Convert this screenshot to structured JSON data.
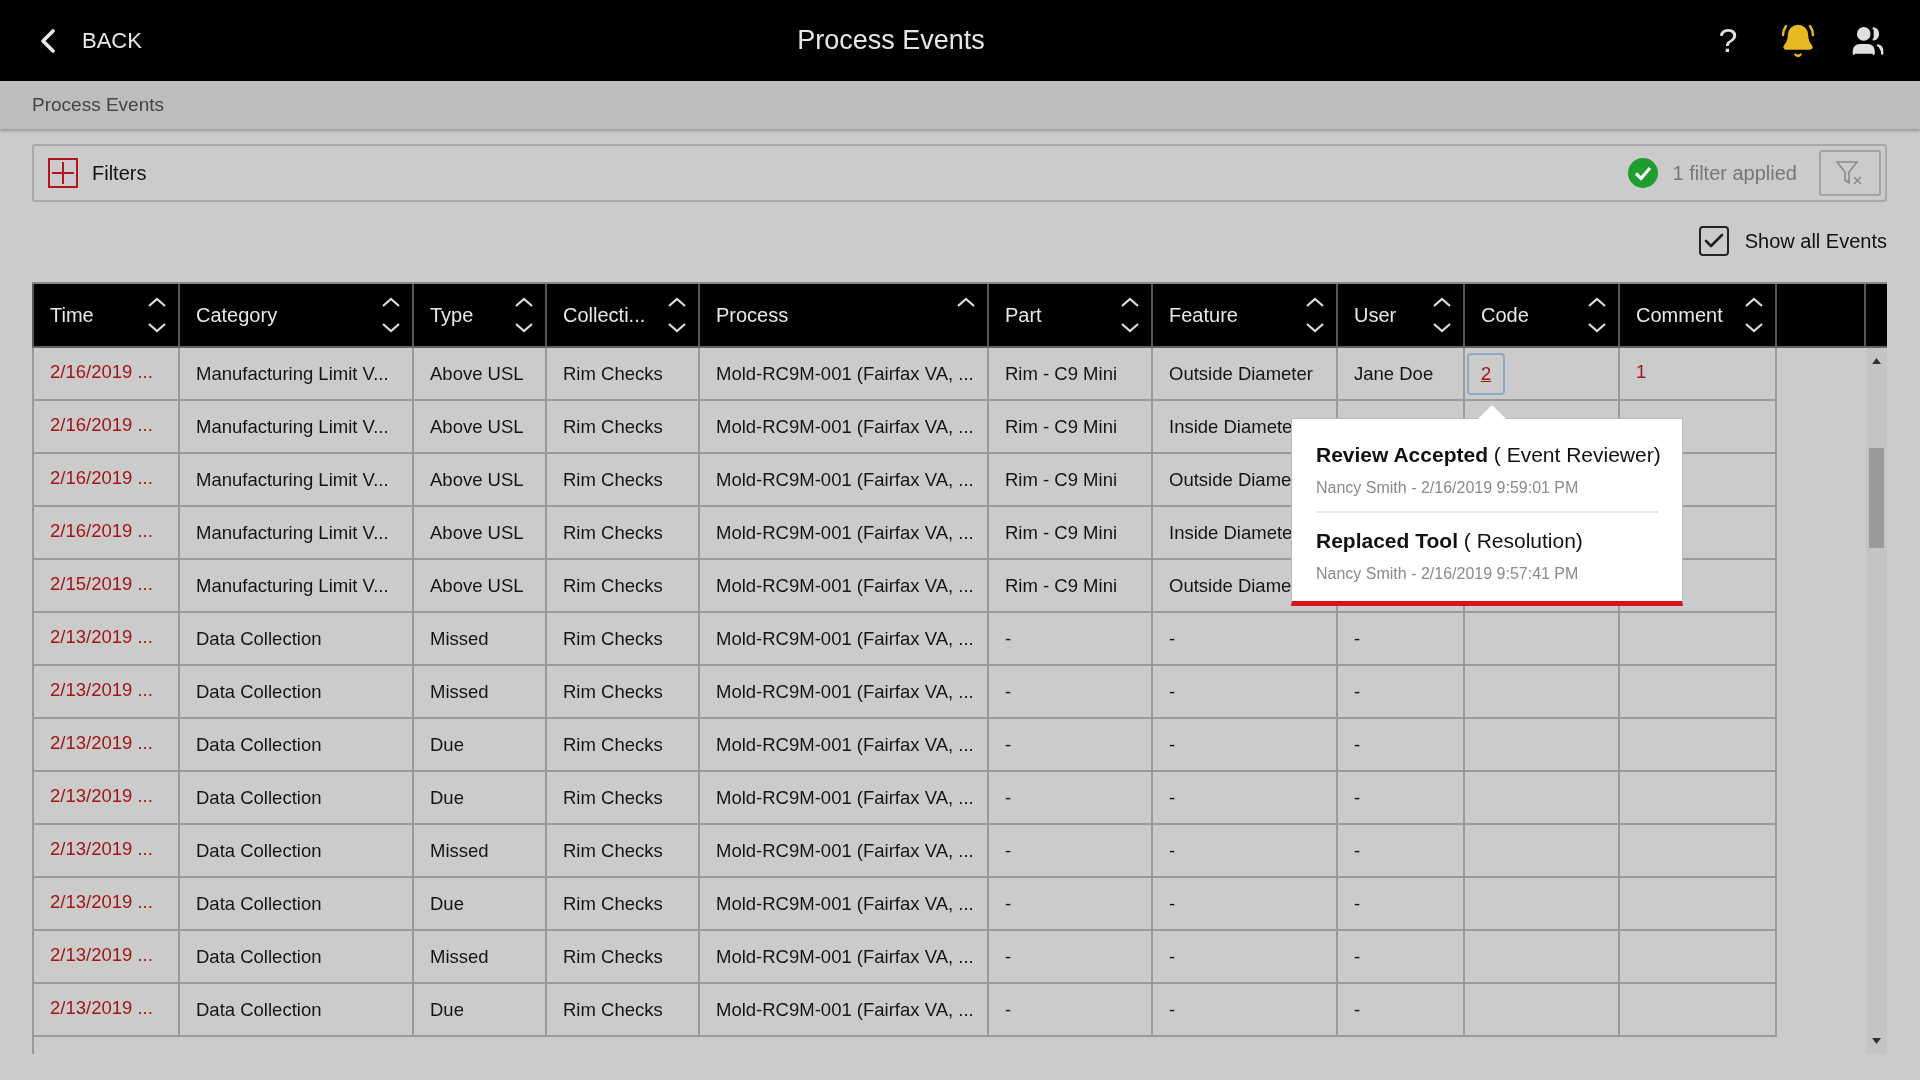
{
  "header": {
    "back_label": "BACK",
    "title": "Process Events",
    "help_label": "?"
  },
  "breadcrumb": "Process Events",
  "filters": {
    "label": "Filters",
    "status": "1 filter applied"
  },
  "show_all_events": {
    "label": "Show all Events",
    "checked": true
  },
  "table": {
    "columns": [
      {
        "label": "Time",
        "sorted": false
      },
      {
        "label": "Category",
        "sorted": false
      },
      {
        "label": "Type",
        "sorted": false
      },
      {
        "label": "Collecti...",
        "sorted": false
      },
      {
        "label": "Process",
        "sorted": true
      },
      {
        "label": "Part",
        "sorted": false
      },
      {
        "label": "Feature",
        "sorted": false
      },
      {
        "label": "User",
        "sorted": false
      },
      {
        "label": "Code",
        "sorted": false
      },
      {
        "label": "Comment",
        "sorted": false
      }
    ],
    "rows": [
      {
        "cells": [
          "2/16/2019 ...",
          "Manufacturing Limit V...",
          "Above USL",
          "Rim Checks",
          "Mold-RC9M-001 (Fairfax VA, ...",
          "Rim - C9 Mini",
          "Outside Diameter",
          "Jane Doe",
          "2",
          "1"
        ]
      },
      {
        "cells": [
          "2/16/2019 ...",
          "Manufacturing Limit V...",
          "Above USL",
          "Rim Checks",
          "Mold-RC9M-001 (Fairfax VA, ...",
          "Rim - C9 Mini",
          "Inside Diamete",
          null,
          null,
          null
        ]
      },
      {
        "cells": [
          "2/16/2019 ...",
          "Manufacturing Limit V...",
          "Above USL",
          "Rim Checks",
          "Mold-RC9M-001 (Fairfax VA, ...",
          "Rim - C9 Mini",
          "Outside Diame",
          null,
          null,
          null
        ]
      },
      {
        "cells": [
          "2/16/2019 ...",
          "Manufacturing Limit V...",
          "Above USL",
          "Rim Checks",
          "Mold-RC9M-001 (Fairfax VA, ...",
          "Rim - C9 Mini",
          "Inside Diamete",
          null,
          null,
          null
        ]
      },
      {
        "cells": [
          "2/15/2019 ...",
          "Manufacturing Limit V...",
          "Above USL",
          "Rim Checks",
          "Mold-RC9M-001 (Fairfax VA, ...",
          "Rim - C9 Mini",
          "Outside Diame",
          null,
          null,
          null
        ]
      },
      {
        "cells": [
          "2/13/2019 ...",
          "Data Collection",
          "Missed",
          "Rim Checks",
          "Mold-RC9M-001 (Fairfax VA, ...",
          "-",
          "-",
          "-",
          null,
          null
        ]
      },
      {
        "cells": [
          "2/13/2019 ...",
          "Data Collection",
          "Missed",
          "Rim Checks",
          "Mold-RC9M-001 (Fairfax VA, ...",
          "-",
          "-",
          "-",
          null,
          null
        ]
      },
      {
        "cells": [
          "2/13/2019 ...",
          "Data Collection",
          "Due",
          "Rim Checks",
          "Mold-RC9M-001 (Fairfax VA, ...",
          "-",
          "-",
          "-",
          null,
          null
        ]
      },
      {
        "cells": [
          "2/13/2019 ...",
          "Data Collection",
          "Due",
          "Rim Checks",
          "Mold-RC9M-001 (Fairfax VA, ...",
          "-",
          "-",
          "-",
          null,
          null
        ]
      },
      {
        "cells": [
          "2/13/2019 ...",
          "Data Collection",
          "Missed",
          "Rim Checks",
          "Mold-RC9M-001 (Fairfax VA, ...",
          "-",
          "-",
          "-",
          null,
          null
        ]
      },
      {
        "cells": [
          "2/13/2019 ...",
          "Data Collection",
          "Due",
          "Rim Checks",
          "Mold-RC9M-001 (Fairfax VA, ...",
          "-",
          "-",
          "-",
          null,
          null
        ]
      },
      {
        "cells": [
          "2/13/2019 ...",
          "Data Collection",
          "Missed",
          "Rim Checks",
          "Mold-RC9M-001 (Fairfax VA, ...",
          "-",
          "-",
          "-",
          null,
          null
        ]
      },
      {
        "cells": [
          "2/13/2019 ...",
          "Data Collection",
          "Due",
          "Rim Checks",
          "Mold-RC9M-001 (Fairfax VA, ...",
          "-",
          "-",
          "-",
          null,
          null
        ]
      }
    ]
  },
  "code_popover": {
    "entries": [
      {
        "title": "**Review Accepted** ( Event Reviewer)",
        "meta": "Nancy Smith - 2/16/2019 9:59:01 PM"
      },
      {
        "title": "**Replaced Tool** ( Resolution)",
        "meta": "Nancy Smith - 2/16/2019 9:57:41 PM"
      }
    ]
  }
}
